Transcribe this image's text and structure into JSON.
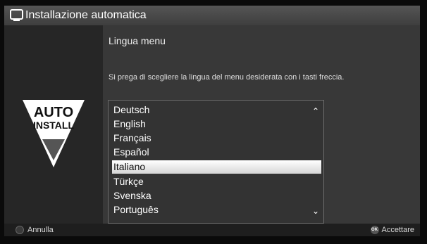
{
  "header": {
    "title": "Installazione automatica",
    "icon": "tv-icon"
  },
  "badge": {
    "line1": "AUTO",
    "line2": "INSTALL"
  },
  "main": {
    "title": "Lingua menu",
    "instruction": "Si prega di scegliere la lingua del menu desiderata con i tasti freccia."
  },
  "languages": {
    "items": [
      "Deutsch",
      "English",
      "Français",
      "Español",
      "Italiano",
      "Türkçe",
      "Svenska",
      "Português"
    ],
    "selected": "Italiano",
    "scroll_up_icon": "chevron-up-icon",
    "scroll_down_icon": "chevron-down-icon"
  },
  "footer": {
    "cancel_label": "Annulla",
    "ok_key": "OK",
    "accept_label": "Accettare"
  }
}
